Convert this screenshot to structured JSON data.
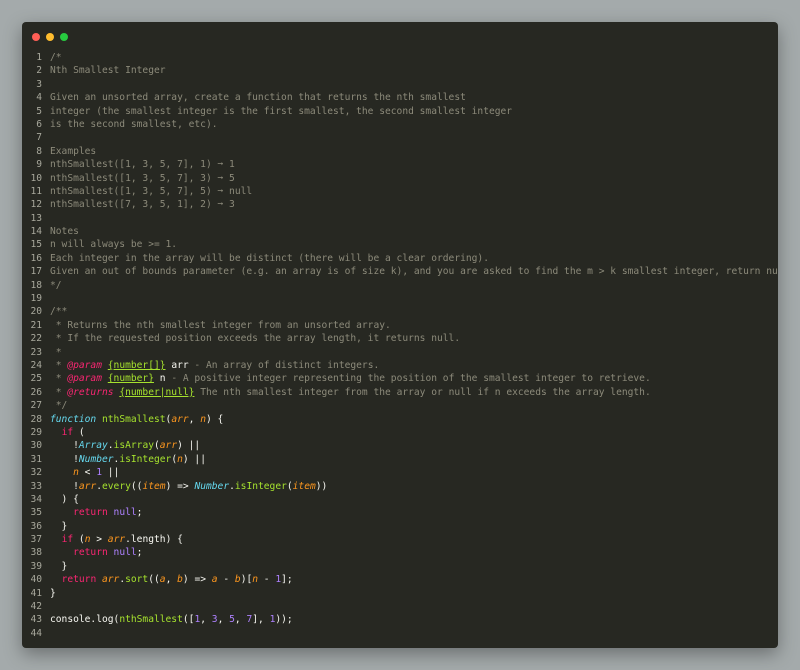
{
  "window": {
    "controls": {
      "close_color": "#ff5f56",
      "minimize_color": "#ffbd2e",
      "maximize_color": "#27c93f"
    }
  },
  "lines": [
    {
      "n": "1",
      "t": "/*"
    },
    {
      "n": "2",
      "t": "Nth Smallest Integer"
    },
    {
      "n": "3",
      "t": ""
    },
    {
      "n": "4",
      "t": "Given an unsorted array, create a function that returns the nth smallest"
    },
    {
      "n": "5",
      "t": "integer (the smallest integer is the first smallest, the second smallest integer"
    },
    {
      "n": "6",
      "t": "is the second smallest, etc)."
    },
    {
      "n": "7",
      "t": ""
    },
    {
      "n": "8",
      "t": "Examples"
    },
    {
      "n": "9",
      "t": "nthSmallest([1, 3, 5, 7], 1) ➞ 1"
    },
    {
      "n": "10",
      "t": "nthSmallest([1, 3, 5, 7], 3) ➞ 5"
    },
    {
      "n": "11",
      "t": "nthSmallest([1, 3, 5, 7], 5) ➞ null"
    },
    {
      "n": "12",
      "t": "nthSmallest([7, 3, 5, 1], 2) ➞ 3"
    },
    {
      "n": "13",
      "t": ""
    },
    {
      "n": "14",
      "t": "Notes"
    },
    {
      "n": "15",
      "t": "n will always be >= 1."
    },
    {
      "n": "16",
      "t": "Each integer in the array will be distinct (there will be a clear ordering)."
    },
    {
      "n": "17",
      "t": "Given an out of bounds parameter (e.g. an array is of size k), and you are asked to find the m > k smallest integer, return null."
    },
    {
      "n": "18",
      "t": "*/"
    },
    {
      "n": "19",
      "t": ""
    },
    {
      "n": "20",
      "t": "/**"
    },
    {
      "n": "21",
      "t": " * Returns the nth smallest integer from an unsorted array."
    },
    {
      "n": "22",
      "t": " * If the requested position exceeds the array length, it returns null."
    },
    {
      "n": "23",
      "t": " *"
    },
    {
      "n": "24",
      "t": " * @param {number[]} arr - An array of distinct integers."
    },
    {
      "n": "25",
      "t": " * @param {number} n - A positive integer representing the position of the smallest integer to retrieve."
    },
    {
      "n": "26",
      "t": " * @returns {number|null} The nth smallest integer from the array or null if n exceeds the array length."
    },
    {
      "n": "27",
      "t": " */"
    },
    {
      "n": "28",
      "t": "function nthSmallest(arr, n) {"
    },
    {
      "n": "29",
      "t": "  if ("
    },
    {
      "n": "30",
      "t": "    !Array.isArray(arr) ||"
    },
    {
      "n": "31",
      "t": "    !Number.isInteger(n) ||"
    },
    {
      "n": "32",
      "t": "    n < 1 ||"
    },
    {
      "n": "33",
      "t": "    !arr.every((item) => Number.isInteger(item))"
    },
    {
      "n": "34",
      "t": "  ) {"
    },
    {
      "n": "35",
      "t": "    return null;"
    },
    {
      "n": "36",
      "t": "  }"
    },
    {
      "n": "37",
      "t": "  if (n > arr.length) {"
    },
    {
      "n": "38",
      "t": "    return null;"
    },
    {
      "n": "39",
      "t": "  }"
    },
    {
      "n": "40",
      "t": "  return arr.sort((a, b) => a - b)[n - 1];"
    },
    {
      "n": "41",
      "t": "}"
    },
    {
      "n": "42",
      "t": ""
    },
    {
      "n": "43",
      "t": "console.log(nthSmallest([1, 3, 5, 7], 1));"
    },
    {
      "n": "44",
      "t": ""
    }
  ]
}
